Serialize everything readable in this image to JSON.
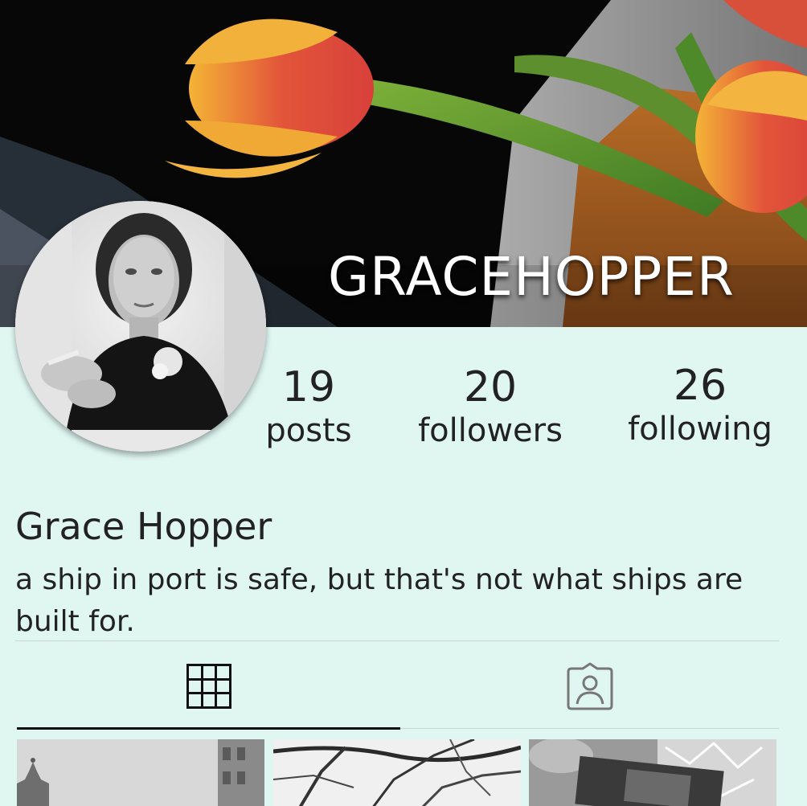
{
  "profile": {
    "username": "GRACEHOPPER",
    "full_name": "Grace Hopper",
    "bio": "a ship in port is safe, but that's not what ships are built for."
  },
  "stats": {
    "posts": {
      "count": "19",
      "label": "posts"
    },
    "followers": {
      "count": "20",
      "label": "followers"
    },
    "following": {
      "count": "26",
      "label": "following"
    }
  },
  "tabs": [
    {
      "icon": "grid-icon",
      "active": true
    },
    {
      "icon": "tagged-person-icon",
      "active": false
    }
  ],
  "colors": {
    "background": "#e0f7f1",
    "text": "#222222",
    "active_tab_icon": "#111111",
    "inactive_tab_icon": "#777777"
  }
}
